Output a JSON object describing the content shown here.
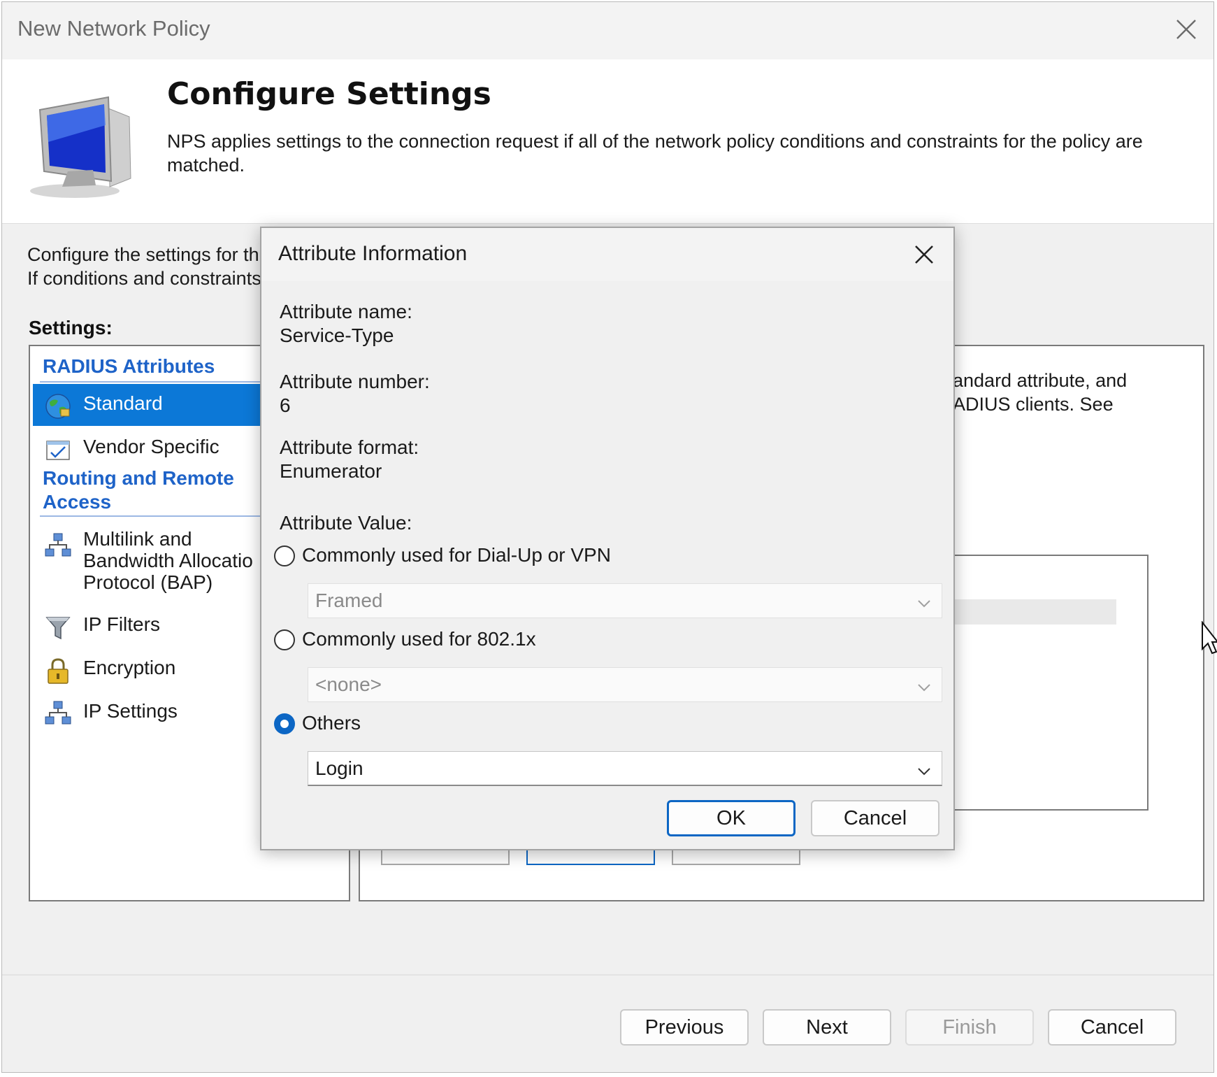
{
  "window": {
    "title": "New Network Policy",
    "heading": "Configure Settings",
    "description_line1": "NPS applies settings to the connection request if all of the network policy conditions and constraints for the policy are",
    "description_line2": "matched."
  },
  "intro": {
    "line1": "Configure the settings for thi",
    "line2": "If conditions and constraints"
  },
  "settings": {
    "label": "Settings:",
    "groups": [
      {
        "label": "RADIUS Attributes"
      },
      {
        "label_line1": "Routing and Remote",
        "label_line2": "Access"
      }
    ],
    "items": [
      {
        "label": "Standard",
        "icon": "globe-icon",
        "selected": true
      },
      {
        "label": "Vendor Specific",
        "icon": "checkbox-window-icon",
        "selected": false
      },
      {
        "label_line1": "Multilink and",
        "label_line2": "Bandwidth Allocatio",
        "label_line3": "Protocol (BAP)",
        "icon": "network-nodes-icon",
        "selected": false
      },
      {
        "label": "IP Filters",
        "icon": "funnel-icon",
        "selected": false
      },
      {
        "label": "Encryption",
        "icon": "padlock-icon",
        "selected": false
      },
      {
        "label": "IP Settings",
        "icon": "network-nodes-icon",
        "selected": false
      }
    ]
  },
  "details_panel": {
    "partial_line1": "andard attribute, and",
    "partial_line2": "ADIUS clients. See"
  },
  "footer": {
    "previous_label": "Previous",
    "next_label": "Next",
    "finish_label": "Finish",
    "cancel_label": "Cancel",
    "finish_enabled": false
  },
  "dialog": {
    "title": "Attribute Information",
    "name_label": "Attribute name:",
    "name_value": "Service-Type",
    "number_label": "Attribute number:",
    "number_value": "6",
    "format_label": "Attribute format:",
    "format_value": "Enumerator",
    "value_label": "Attribute Value:",
    "options": [
      {
        "label": "Commonly used for Dial-Up or VPN",
        "checked": false,
        "select_value": "Framed",
        "enabled": false
      },
      {
        "label": "Commonly used for 802.1x",
        "checked": false,
        "select_value": "<none>",
        "enabled": false
      },
      {
        "label": "Others",
        "checked": true,
        "select_value": "Login",
        "enabled": true
      }
    ],
    "ok_label": "OK",
    "cancel_label": "Cancel"
  },
  "colors": {
    "accent": "#0c78d7",
    "group_heading": "#1e63c8",
    "window_bg": "#f0f0f0"
  }
}
